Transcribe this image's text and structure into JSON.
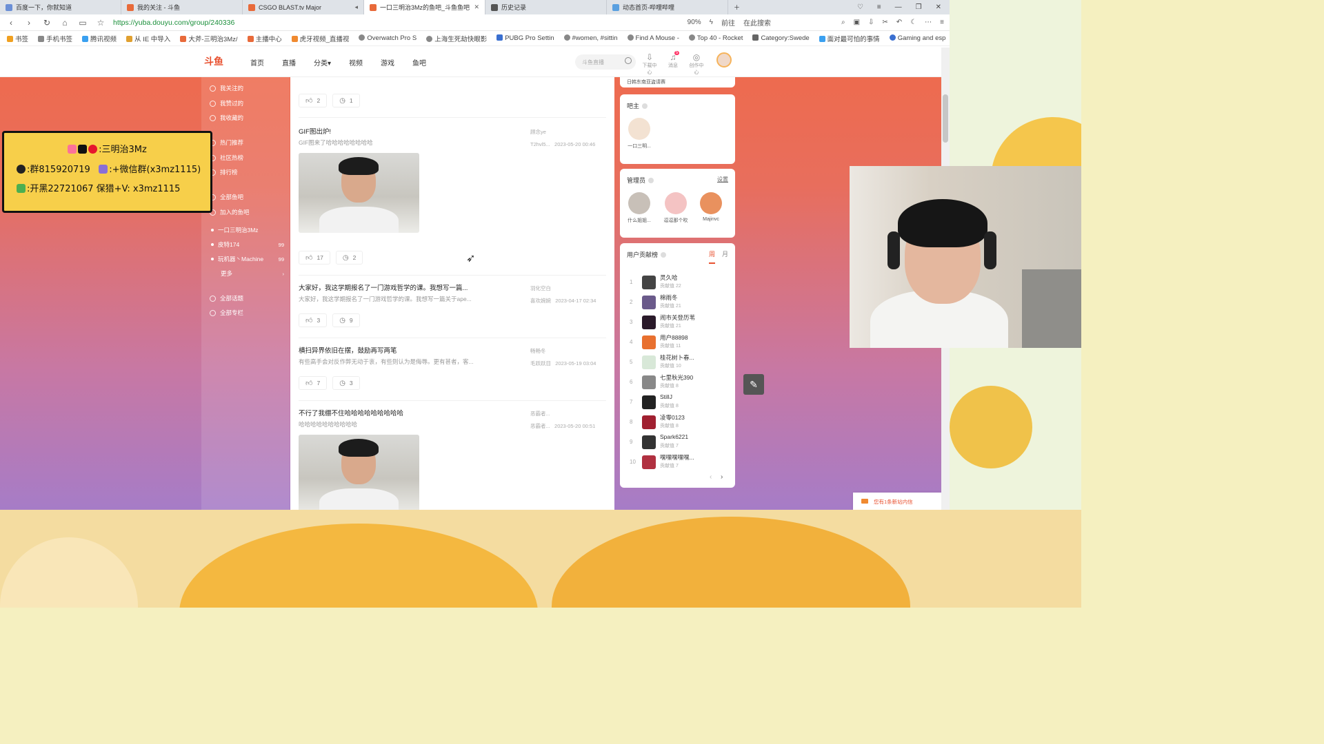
{
  "browser": {
    "tabs": [
      {
        "title": "百度一下，你就知道",
        "active": false
      },
      {
        "title": "我的关注 - 斗鱼",
        "active": false
      },
      {
        "title": "CSGO BLAST.tv Major",
        "active": false
      },
      {
        "title": "一口三明治3Mz的鱼吧_斗鱼鱼吧",
        "active": true
      },
      {
        "title": "历史记录",
        "active": false
      },
      {
        "title": "动态首页-哔哩哔哩",
        "active": false
      }
    ],
    "url": "https://yuba.douyu.com/group/240336",
    "zoom": "90%",
    "goto_label": "前往",
    "search_placeholder": "在此搜索",
    "bookmarks": [
      "书签",
      "手机书签",
      "腾讯视频",
      "从 IE 中导入",
      "大斧-三明治3Mz/",
      "主播中心",
      "虎牙视频_直播视",
      "Overwatch Pro S",
      "上海生死劫快眼影",
      "PUBG Pro Settin",
      "#women, #sittin",
      "Find A Mouse -",
      "Top 40 - Rocket",
      "Category:Swede",
      "面对最可怕的事情",
      "Gaming and esp"
    ]
  },
  "site": {
    "logo": "斗鱼",
    "nav": [
      "首页",
      "直播",
      "分类",
      "视频",
      "游戏",
      "鱼吧"
    ],
    "search_placeholder": "斗鱼直播",
    "header_icons": [
      "下载中心",
      "消息",
      "创作中心"
    ],
    "msg_badge": "5"
  },
  "leftmenu": {
    "items": [
      "我关注的",
      "我赞过的",
      "我收藏的",
      "热门推荐",
      "社区热榜",
      "排行榜",
      "全部鱼吧",
      "加入的鱼吧"
    ],
    "groups": [
      {
        "name": "一口三明治3Mz",
        "count": ""
      },
      {
        "name": "皮特174",
        "count": "99"
      },
      {
        "name": "玩机器丶Machine",
        "count": "99"
      },
      {
        "name": "更多",
        "count": ""
      }
    ],
    "bottom": [
      "全部话题",
      "全部专栏"
    ]
  },
  "feed": {
    "top_actions": {
      "likes": "2",
      "comments": "1"
    },
    "posts": [
      {
        "title": "GIF图出炉!",
        "desc": "GIF图来了哈哈哈哈哈哈哈哈",
        "author": "顾念ye",
        "device": "T2hvl5...",
        "time": "2023-05-20 00:46",
        "likes": "17",
        "comments": "2"
      },
      {
        "title": "大家好，我这学期报名了一门游戏哲学的课。我想写一篇...",
        "desc": "大家好，我这学期报名了一门游戏哲学的课。我想写一篇关于ape...",
        "author": "羽化空白",
        "device": "喜欢婉婉",
        "time": "2023-04-17 02:34",
        "likes": "3",
        "comments": "9"
      },
      {
        "title": "横扫异界依旧在摆，鼓励再写两笔",
        "desc": "有些高手会对反作弊无动于衷，有些则认为是侮辱。更有甚者，客...",
        "author": "畅畅冬",
        "device": "毛跃跃目",
        "time": "2023-05-19 03:04",
        "likes": "7",
        "comments": "3"
      },
      {
        "title": "不行了我绷不住哈哈哈哈哈哈哈哈哈",
        "desc": "哈哈哈哈哈哈哈哈哈哈",
        "author": "恶霸者...",
        "device": "恶霸者...",
        "time": "2023-05-20 00:51"
      }
    ]
  },
  "right": {
    "top_text": "日韩东南亚盗请赛",
    "owner_title": "吧主",
    "owner_name": "一口三明...",
    "admins_title": "管理员",
    "admins_link": "设置",
    "admins": [
      "什么姐姐...",
      "逗逗那个吹",
      "Majinvc"
    ],
    "rank_title": "用户贡献榜",
    "rank_tabs": [
      "周",
      "月"
    ],
    "rank": [
      {
        "n": "1",
        "name": "灵久哈",
        "score": "贡献值 22"
      },
      {
        "n": "2",
        "name": "棉雨冬",
        "score": "贡献值 21"
      },
      {
        "n": "3",
        "name": "闹市关登历苇",
        "score": "贡献值 21"
      },
      {
        "n": "4",
        "name": "用户88898",
        "score": "贡献值 11"
      },
      {
        "n": "5",
        "name": "桂花树卜春...",
        "score": "贡献值 10"
      },
      {
        "n": "6",
        "name": "七里秋光390",
        "score": "贡献值 8"
      },
      {
        "n": "7",
        "name": "StillJ",
        "score": "贡献值 8"
      },
      {
        "n": "8",
        "name": "凌零0123",
        "score": "贡献值 8"
      },
      {
        "n": "9",
        "name": "Spark6221",
        "score": "贡献值 7"
      },
      {
        "n": "10",
        "name": "嘿嘿嘿嘿嘿...",
        "score": "贡献值 7"
      }
    ],
    "notice": "您有1条新站内信"
  },
  "overlay": {
    "line1": ":三明治3Mz",
    "line2a": ":群815920719",
    "line2b": ":+微信群(x3mz1115)",
    "line3": ":开黑22721067  保猎+V: x3mz1115"
  }
}
